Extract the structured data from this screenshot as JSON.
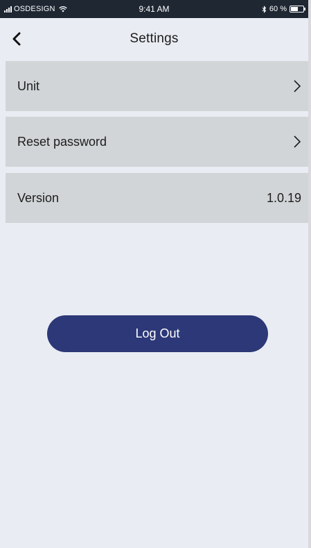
{
  "status_bar": {
    "carrier": "OSDESIGN",
    "time": "9:41 AM",
    "battery_text": "60 %",
    "battery_level": 0.6
  },
  "nav": {
    "title": "Settings"
  },
  "settings": {
    "unit_label": "Unit",
    "reset_label": "Reset password",
    "version_label": "Version",
    "version_value": "1.0.19"
  },
  "actions": {
    "logout_label": "Log Out"
  },
  "colors": {
    "background": "#e9ecf2",
    "row_background": "#d2d5d7",
    "status_bar": "#1f2733",
    "logout_button": "#2c3877"
  },
  "icons": {
    "back": "chevron-left-icon",
    "row_arrow": "chevron-right-icon",
    "signal": "signal-icon",
    "wifi": "wifi-icon",
    "bluetooth": "bluetooth-icon",
    "battery": "battery-icon"
  }
}
